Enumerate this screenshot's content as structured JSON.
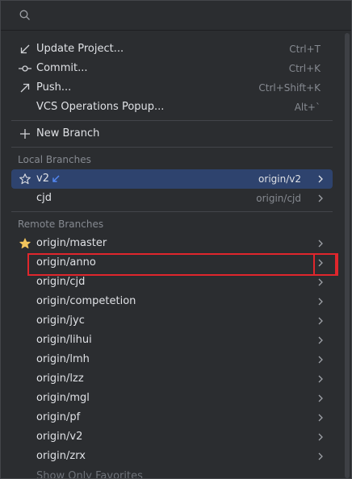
{
  "search": {
    "placeholder": ""
  },
  "actions": [
    {
      "icon": "update-arrow-icon",
      "label": "Update Project...",
      "shortcut": "Ctrl+T"
    },
    {
      "icon": "commit-icon",
      "label": "Commit...",
      "shortcut": "Ctrl+K"
    },
    {
      "icon": "push-arrow-icon",
      "label": "Push...",
      "shortcut": "Ctrl+Shift+K"
    },
    {
      "icon": "",
      "label": "VCS Operations Popup...",
      "shortcut": "Alt+`"
    }
  ],
  "new_branch": {
    "label": "New Branch"
  },
  "local_branches": {
    "header": "Local Branches",
    "items": [
      {
        "name": "v2",
        "tracking": "origin/v2",
        "favorite": false,
        "selected": true,
        "incoming": true
      },
      {
        "name": "cjd",
        "tracking": "origin/cjd",
        "favorite": false,
        "selected": false,
        "incoming": false
      }
    ]
  },
  "remote_branches": {
    "header": "Remote Branches",
    "items": [
      {
        "name": "origin/master",
        "favorite": true
      },
      {
        "name": "origin/anno",
        "favorite": false
      },
      {
        "name": "origin/cjd",
        "favorite": false
      },
      {
        "name": "origin/competetion",
        "favorite": false
      },
      {
        "name": "origin/jyc",
        "favorite": false
      },
      {
        "name": "origin/lihui",
        "favorite": false
      },
      {
        "name": "origin/lmh",
        "favorite": false
      },
      {
        "name": "origin/lzz",
        "favorite": false
      },
      {
        "name": "origin/mgl",
        "favorite": false
      },
      {
        "name": "origin/pf",
        "favorite": false
      },
      {
        "name": "origin/v2",
        "favorite": false
      },
      {
        "name": "origin/zrx",
        "favorite": false
      }
    ]
  },
  "footer": {
    "label": "Show Only Favorites"
  },
  "colors": {
    "background": "#2b2d30",
    "selection": "#2e436e",
    "highlight_box": "#e0262c",
    "favorite_star": "#f2c55c",
    "incoming_arrow": "#548af7"
  }
}
